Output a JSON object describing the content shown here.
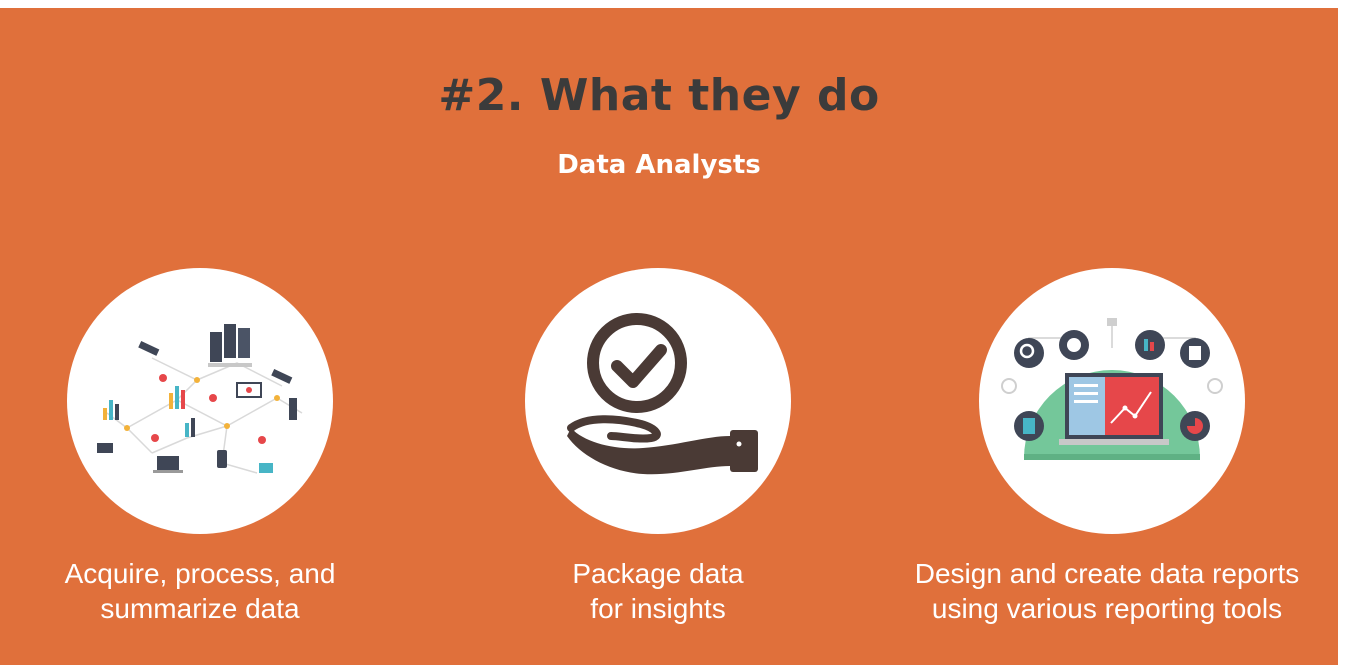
{
  "slide": {
    "title": "#2. What they do",
    "subtitle": "Data Analysts",
    "background_color": "#e0703b",
    "items": [
      {
        "icon": "data-network-icon",
        "caption_line1": "Acquire, process, and",
        "caption_line2": "summarize data"
      },
      {
        "icon": "hand-checkmark-icon",
        "caption_line1": "Package data",
        "caption_line2": "for insights"
      },
      {
        "icon": "reporting-dashboard-icon",
        "caption_line1": "Design and create data reports",
        "caption_line2": "using various reporting tools"
      }
    ]
  }
}
